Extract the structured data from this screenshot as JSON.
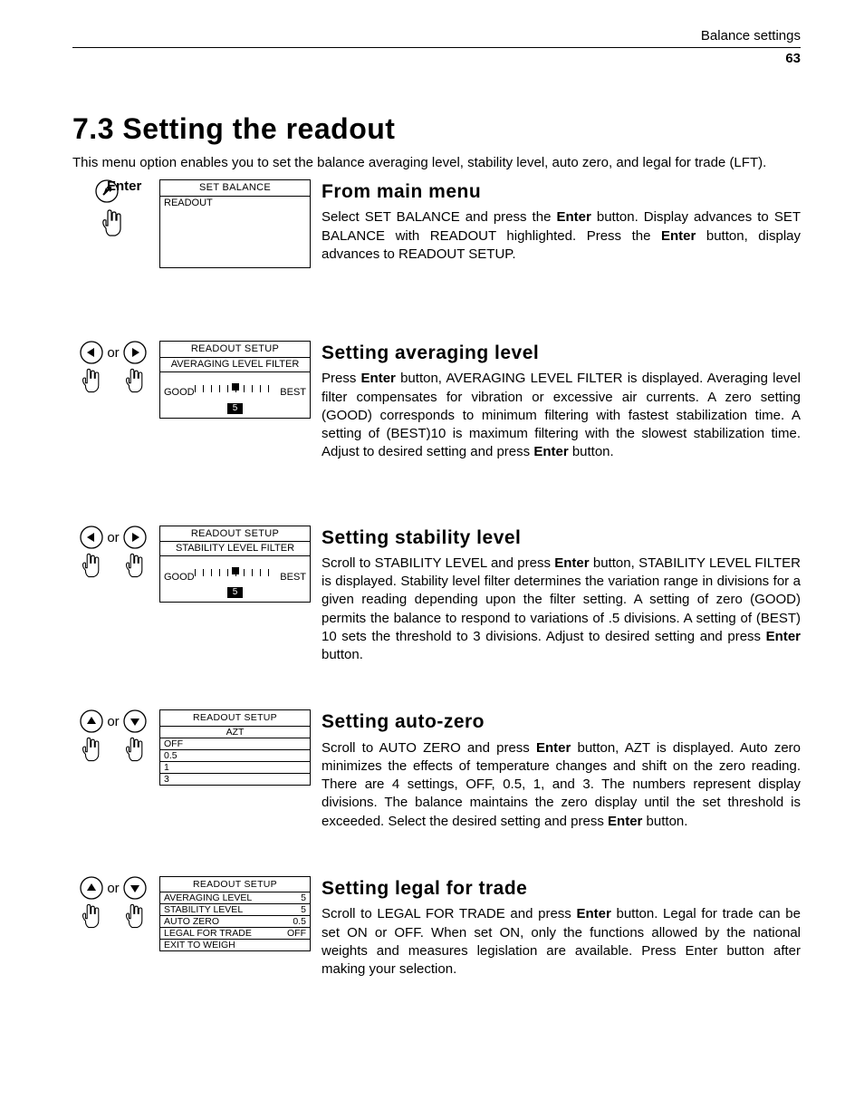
{
  "header": {
    "doc_section": "Balance settings",
    "page_number": "63"
  },
  "title": "7.3  Setting the readout",
  "intro": "This menu option enables you to set the balance averaging level, stability level, auto zero, and legal for trade (LFT).",
  "blocks": {
    "main": {
      "btn_label": "Enter",
      "display": {
        "hdr": "SET BALANCE",
        "line1": "READOUT"
      },
      "heading": "From main menu",
      "p1a": "Select SET BALANCE and press the ",
      "p1b": " button. Display advances to SET BALANCE with READOUT highlighted. Press the ",
      "p1c": " button, display advances to READOUT SETUP.",
      "kw": "Enter"
    },
    "avg": {
      "or": "or",
      "display": {
        "hdr": "READOUT SETUP",
        "sub": "AVERAGING LEVEL FILTER",
        "good": "GOOD",
        "best": "BEST",
        "val": "5"
      },
      "heading": "Setting averaging level",
      "p_a": "Press ",
      "p_b": " button, AVERAGING LEVEL FILTER is displayed. Averaging level filter compensates for vibration or excessive air currents. A zero setting (GOOD) corresponds to minimum filtering with fastest stabilization time. A setting of (BEST)10 is maximum filtering with the slowest stabilization time. Adjust to desired setting and press ",
      "p_c": " button.",
      "kw": "Enter"
    },
    "stab": {
      "or": "or",
      "display": {
        "hdr": "READOUT SETUP",
        "sub": "STABILITY LEVEL FILTER",
        "good": "GOOD",
        "best": "BEST",
        "val": "5"
      },
      "heading": "Setting stability level",
      "p_a": "Scroll to STABILITY LEVEL and press ",
      "p_b": " button, STABILITY LEVEL FILTER is displayed. Stability level filter determines the variation range in divisions for a given reading depending upon the filter setting. A setting of zero (GOOD) permits the balance to respond to variations of .5 divisions. A setting of (BEST) 10 sets the threshold to 3 divisions. Adjust to desired setting and press ",
      "p_c": " button.",
      "kw": "Enter"
    },
    "azt": {
      "or": "or",
      "display": {
        "hdr": "READOUT SETUP",
        "sub": "AZT",
        "opts": [
          "OFF",
          "0.5",
          "1",
          "3"
        ]
      },
      "heading": "Setting auto-zero",
      "p_a": "Scroll to AUTO ZERO and press ",
      "p_b": " button, AZT is displayed. Auto zero minimizes the effects of temperature changes and shift on the zero reading. There are 4 settings, OFF, 0.5, 1, and 3. The numbers represent display divisions. The balance maintains the zero display until the set threshold is exceeded. Select the desired setting and press ",
      "p_c": " button.",
      "kw": "Enter"
    },
    "lft": {
      "or": "or",
      "display": {
        "hdr": "READOUT SETUP",
        "rows": [
          {
            "k": "AVERAGING LEVEL",
            "v": "5"
          },
          {
            "k": "STABILITY LEVEL",
            "v": "5"
          },
          {
            "k": "AUTO ZERO",
            "v": "0.5"
          },
          {
            "k": "LEGAL FOR TRADE",
            "v": "OFF"
          },
          {
            "k": "EXIT TO WEIGH",
            "v": ""
          }
        ]
      },
      "heading": "Setting legal for trade",
      "p_a": "Scroll to LEGAL FOR TRADE  and press ",
      "p_b": " button. Legal for trade can be set ON or OFF. When set ON, only the functions allowed by the national weights and measures legislation are available. Press Enter button after making your selection.",
      "kw": "Enter"
    }
  }
}
